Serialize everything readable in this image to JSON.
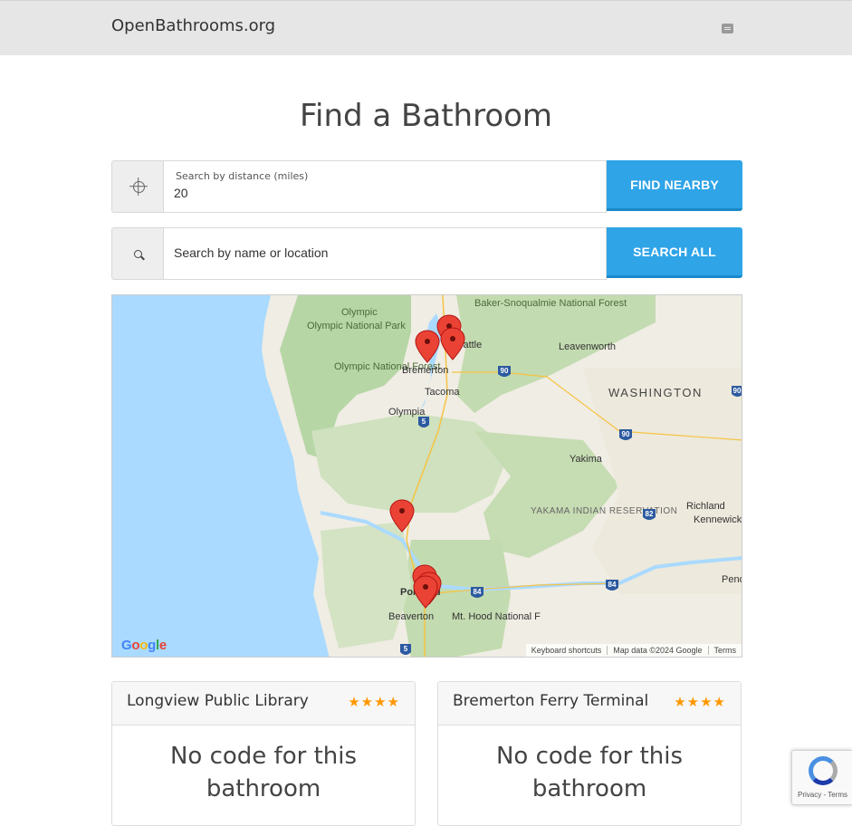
{
  "navbar": {
    "brand": "OpenBathrooms.org",
    "menu_icon": "book-icon"
  },
  "title": "Find a Bathroom",
  "distance_search": {
    "icon": "crosshair-icon",
    "label": "Search by distance (miles)",
    "value": "20",
    "button": "Find Nearby"
  },
  "name_search": {
    "icon": "search-icon",
    "placeholder": "Search by name or location",
    "button": "Search All"
  },
  "map": {
    "labels": {
      "national_park": "Olympic National Park",
      "national_forest": "Olympic National Forest",
      "baker": "Baker-Snoqualmie National Forest",
      "seattle": "Seattle",
      "bremerton": "Bremerton",
      "tacoma": "Tacoma",
      "olympia": "Olympia",
      "leavenworth": "Leavenworth",
      "washington": "WASHINGTON",
      "yakima": "Yakima",
      "reservation": "YAKAMA INDIAN RESERVATION",
      "richland": "Richland",
      "kennewick": "Kennewick",
      "portland": "Portland",
      "beaverton": "Beaverton",
      "mthood": "Mt. Hood National F",
      "pend": "Pend"
    },
    "shields": [
      "90",
      "90",
      "90",
      "82",
      "84",
      "84",
      "5",
      "5"
    ],
    "footer": {
      "shortcuts": "Keyboard shortcuts",
      "attribution": "Map data ©2024 Google",
      "terms": "Terms"
    },
    "logo": "Google"
  },
  "cards": [
    {
      "title": "Longview Public Library",
      "stars": "★★★★",
      "body": "No code for this bathroom"
    },
    {
      "title": "Bremerton Ferry Terminal",
      "stars": "★★★★",
      "body": "No code for this bathroom"
    }
  ],
  "recaptcha": {
    "links": "Privacy - Terms"
  },
  "colors": {
    "accent": "#2fa4e7",
    "star": "#ff9800",
    "marker": "#ea4335"
  }
}
